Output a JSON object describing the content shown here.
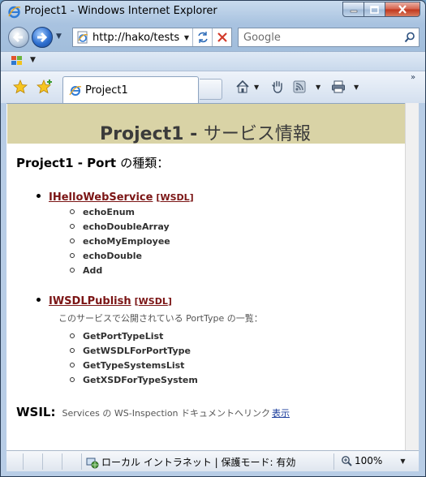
{
  "window": {
    "title": "Project1 - Windows Internet Explorer"
  },
  "nav": {
    "address": "http://hako/tests",
    "search_placeholder": "Google"
  },
  "tabs": [
    {
      "label": "Project1"
    }
  ],
  "page": {
    "title_main": "Project1 - ",
    "title_jp": "サービス情報",
    "ports_heading_main": "Project1 - Port ",
    "ports_heading_jp": "の種類：",
    "services": [
      {
        "name": "IHelloWebService",
        "wsdl_label": "WSDL",
        "description": "",
        "operations": [
          "echoEnum",
          "echoDoubleArray",
          "echoMyEmployee",
          "echoDouble",
          "Add"
        ]
      },
      {
        "name": "IWSDLPublish",
        "wsdl_label": "WSDL",
        "description": "このサービスで公開されている PortType の一覧：",
        "operations": [
          "GetPortTypeList",
          "GetWSDLForPortType",
          "GetTypeSystemsList",
          "GetXSDForTypeSystem"
        ]
      }
    ],
    "wsil": {
      "label": "WSIL:",
      "text": "Services の WS-Inspection ドキュメントへリンク",
      "link": "表示"
    }
  },
  "status": {
    "zone": "ローカル イントラネット | 保護モード: 有効",
    "zoom": "100%"
  },
  "colors": {
    "heading_band": "#d9d3a6",
    "link": "#7b1515"
  }
}
